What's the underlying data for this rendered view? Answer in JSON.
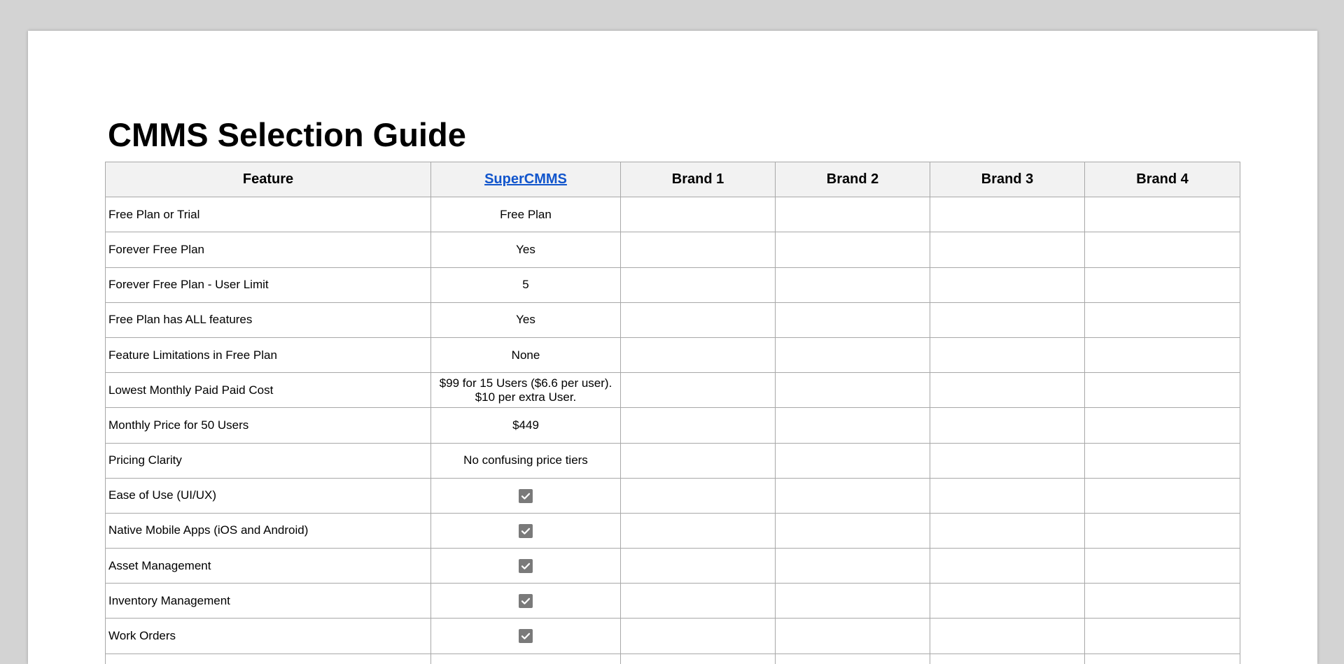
{
  "document": {
    "title": "CMMS Selection Guide"
  },
  "table": {
    "headers": {
      "feature": "Feature",
      "supercmms": "SuperCMMS",
      "brand1": "Brand 1",
      "brand2": "Brand 2",
      "brand3": "Brand 3",
      "brand4": "Brand 4"
    },
    "rows": [
      {
        "feature": "Free Plan or Trial",
        "value": "Free Plan"
      },
      {
        "feature": "Forever Free Plan",
        "value": "Yes"
      },
      {
        "feature": "Forever Free Plan - User Limit",
        "value": "5"
      },
      {
        "feature": "Free Plan has ALL features",
        "value": "Yes"
      },
      {
        "feature": "Feature Limitations in Free Plan",
        "value": "None"
      },
      {
        "feature": "Lowest Monthly Paid Paid Cost",
        "value_line1": "$99 for 15 Users ($6.6 per user).",
        "value_line2": "$10 per extra User."
      },
      {
        "feature": "Monthly Price for 50 Users",
        "value": "$449"
      },
      {
        "feature": "Pricing Clarity",
        "value": "No confusing price tiers"
      },
      {
        "feature": "Ease of Use (UI/UX)",
        "checked": true
      },
      {
        "feature": "Native Mobile Apps (iOS and Android)",
        "checked": true
      },
      {
        "feature": "Asset Management",
        "checked": true
      },
      {
        "feature": "Inventory Management",
        "checked": true
      },
      {
        "feature": "Work Orders",
        "checked": true
      }
    ]
  },
  "colors": {
    "page_background": "#d3d3d3",
    "header_background": "#f2f2f2",
    "grid_line": "#a8a8a8",
    "link": "#1155cc",
    "checkbox_fill": "#7a7a7a"
  },
  "icons": {
    "checkbox": "checkbox-checked-icon"
  }
}
